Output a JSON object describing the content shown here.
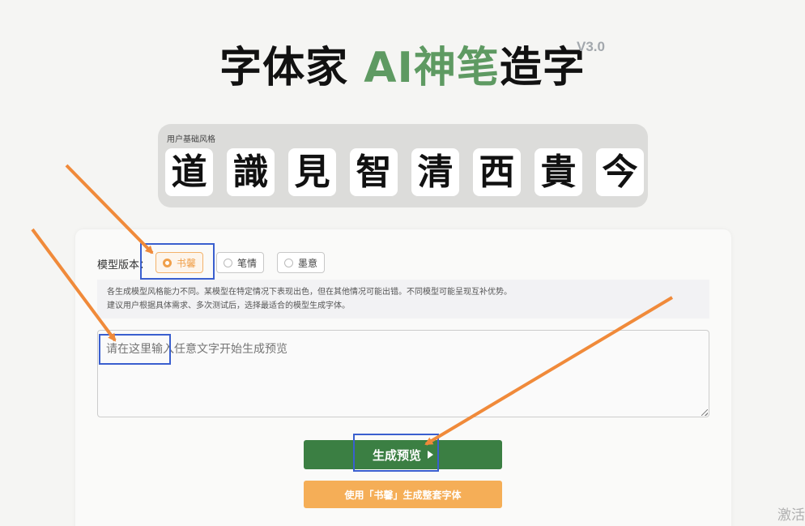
{
  "header": {
    "title_part1": "字体家 ",
    "title_part2": "AI神笔",
    "title_part3": "造字",
    "version": "V3.0"
  },
  "style_panel": {
    "label": "用户基础风格",
    "tiles": [
      "道",
      "識",
      "見",
      "智",
      "清",
      "西",
      "貴",
      "今"
    ]
  },
  "model": {
    "label": "模型版本：",
    "options": [
      {
        "label": "书馨",
        "selected": true
      },
      {
        "label": "笔情",
        "selected": false
      },
      {
        "label": "墨意",
        "selected": false
      }
    ],
    "description_line1": "各生成模型风格能力不同。某模型在特定情况下表现出色，但在其他情况可能出错。不同模型可能呈现互补优势。",
    "description_line2": "建议用户根据具体需求、多次测试后，选择最适合的模型生成字体。"
  },
  "input": {
    "placeholder": "请在这里输入任意文字开始生成预览"
  },
  "buttons": {
    "preview": "生成预览",
    "full_font": "使用「书馨」生成整套字体"
  },
  "watermark": "激活",
  "colors": {
    "brand_green": "#3b7f43",
    "title_green": "#5e9a62",
    "accent_orange": "#f5ae57",
    "annotation_blue": "#3a5fcf",
    "annotation_arrow": "#f08a3a"
  }
}
